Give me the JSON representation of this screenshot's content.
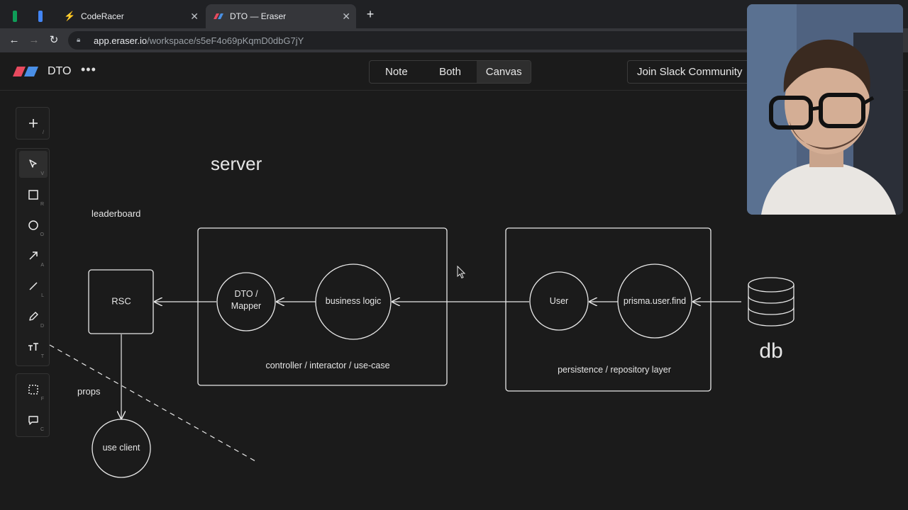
{
  "browser": {
    "tabs": [
      {
        "title": "",
        "icon": "sheets-icon",
        "color": "#0f9d58"
      },
      {
        "title": "",
        "icon": "docs-icon",
        "color": "#4285f4"
      },
      {
        "title": "CodeRacer",
        "icon": "bolt-icon",
        "color": "#f4d03f"
      },
      {
        "title": "DTO — Eraser",
        "icon": "eraser-logo-icon",
        "color": "#e84a5f",
        "active": true
      }
    ],
    "url_host": "app.eraser.io",
    "url_path": "/workspace/s5eF4o69pKqmD0dbG7jY"
  },
  "app": {
    "doc_title": "DTO",
    "modes": [
      "Note",
      "Both",
      "Canvas"
    ],
    "active_mode": "Canvas",
    "slack_button": "Join Slack Community"
  },
  "tools": [
    {
      "name": "add",
      "key": "/"
    },
    {
      "name": "select",
      "key": "V"
    },
    {
      "name": "rectangle",
      "key": "R"
    },
    {
      "name": "ellipse",
      "key": "O"
    },
    {
      "name": "arrow",
      "key": "A"
    },
    {
      "name": "line",
      "key": "L"
    },
    {
      "name": "pencil",
      "key": "D"
    },
    {
      "name": "text",
      "key": "T"
    },
    {
      "name": "frame",
      "key": "F"
    },
    {
      "name": "comment",
      "key": "C"
    }
  ],
  "diagram": {
    "server_label": "server",
    "leaderboard_label": "leaderboard",
    "rsc": "RSC",
    "dto_mapper_line1": "DTO /",
    "dto_mapper_line2": "Mapper",
    "business_logic": "business logic",
    "controller_label": "controller / interactor / use-case",
    "user": "User",
    "prisma": "prisma.user.find",
    "persistence_label": "persistence / repository layer",
    "db": "db",
    "props": "props",
    "use_client": "use client"
  }
}
